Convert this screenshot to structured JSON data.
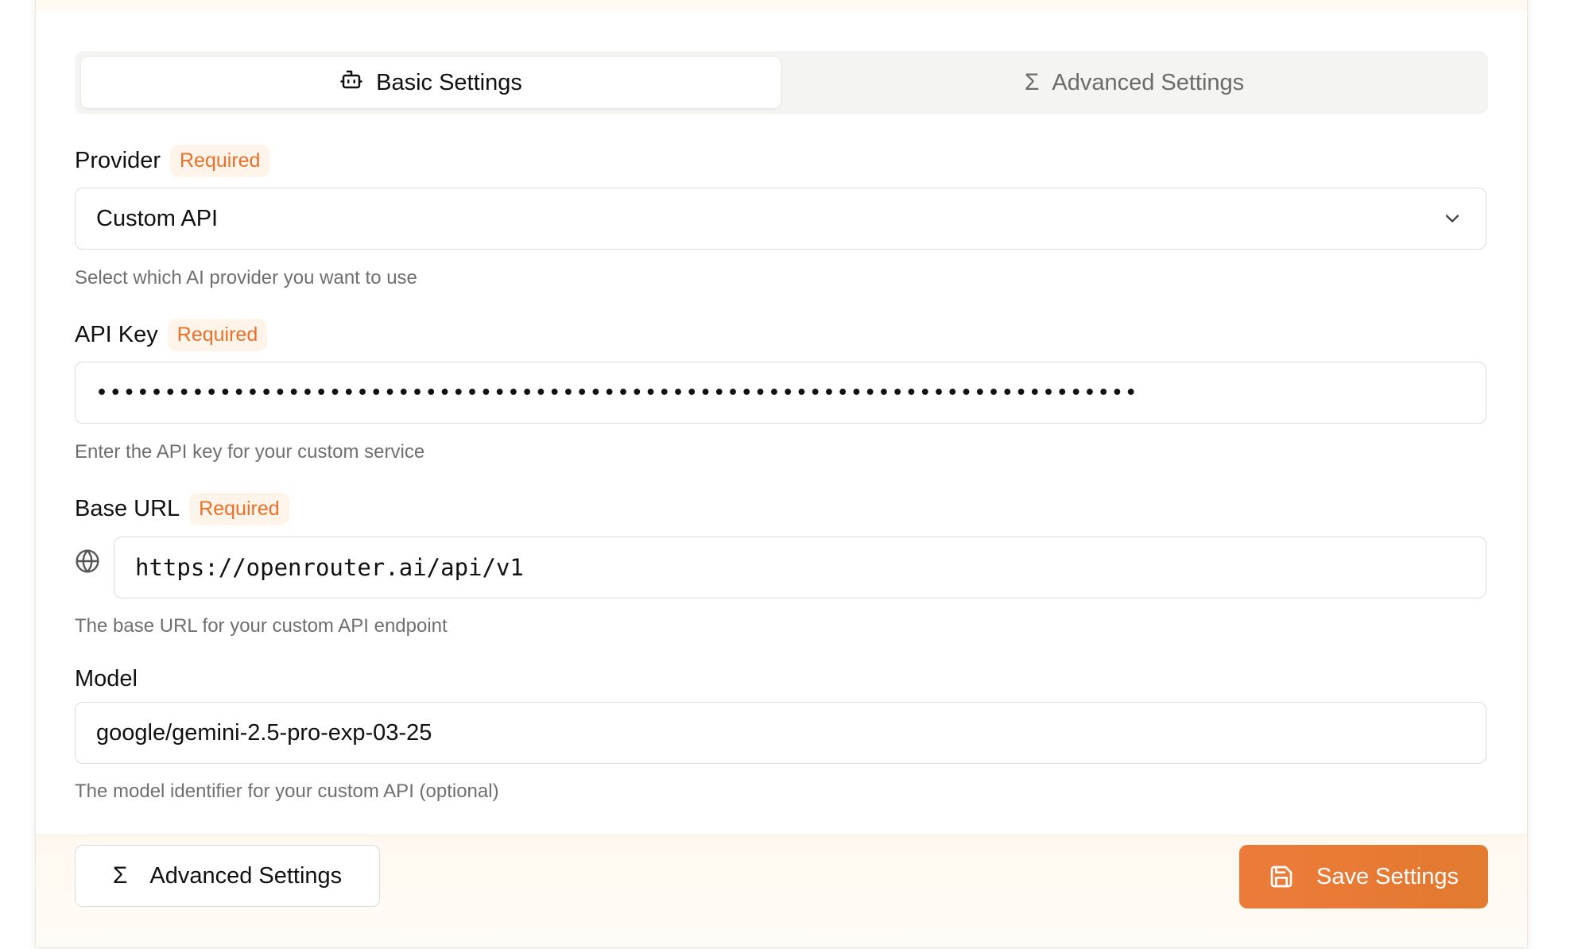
{
  "tabs": {
    "basic_label": "Basic Settings",
    "advanced_label": "Advanced Settings",
    "basic_icon": "bot-icon",
    "advanced_icon": "sigma-icon"
  },
  "provider": {
    "label": "Provider",
    "badge": "Required",
    "value": "Custom API",
    "hint": "Select which AI provider you want to use"
  },
  "api_key": {
    "label": "API Key",
    "badge": "Required",
    "value": "••••••••••••••••••••••••••••••••••••••••••••••••••••••••••••••••••••••••••••",
    "hint": "Enter the API key for your custom service"
  },
  "base_url": {
    "label": "Base URL",
    "badge": "Required",
    "value": "https://openrouter.ai/api/v1",
    "hint": "The base URL for your custom API endpoint"
  },
  "model": {
    "label": "Model",
    "value": "google/gemini-2.5-pro-exp-03-25",
    "hint": "The model identifier for your custom API (optional)"
  },
  "footer": {
    "advanced_button": "Advanced Settings",
    "save_button": "Save Settings"
  },
  "colors": {
    "accent": "#e8702a",
    "badge_bg": "#fff4ea"
  }
}
